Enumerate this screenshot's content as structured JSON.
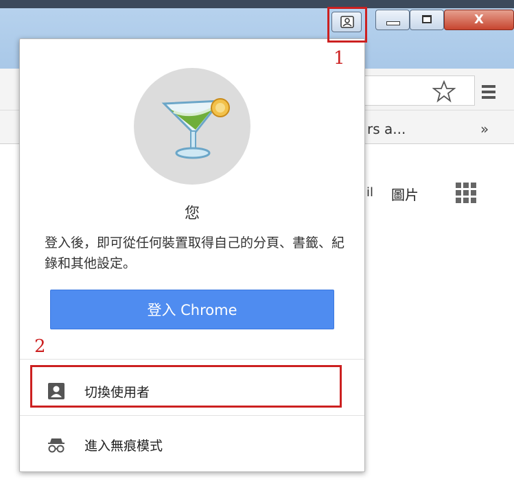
{
  "window": {
    "close_glyph": "X",
    "accent_close": "#c7452f",
    "titlebar_color": "#b0ccea"
  },
  "toolbar": {
    "bookmark_partial": "rs a...",
    "bookmark_overflow": "»"
  },
  "content": {
    "partial_link": "il",
    "images_link": "圖片"
  },
  "profile_popup": {
    "user_name": "您",
    "description": "登入後，即可從任何裝置取得自己的分頁、書籤、紀錄和其他設定。",
    "signin_button": "登入 Chrome",
    "switch_user_label": "切換使用者",
    "incognito_label": "進入無痕模式",
    "signin_color": "#4f8cf0"
  },
  "annotations": {
    "label_1": "1",
    "label_2": "2",
    "color": "#cc2020"
  }
}
